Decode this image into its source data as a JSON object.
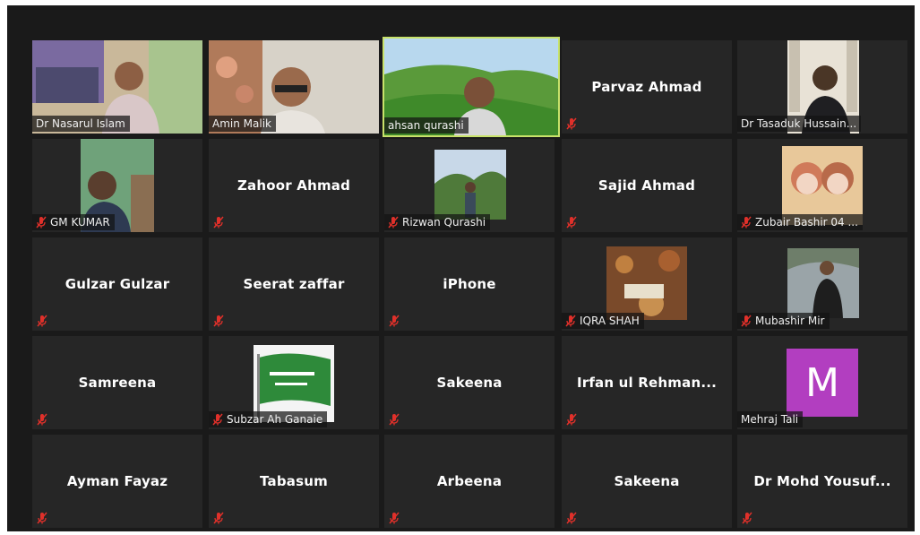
{
  "participants": [
    {
      "name": "Dr Nasarul Islam",
      "muted": false,
      "video": true
    },
    {
      "name": "Amin Malik",
      "muted": false,
      "video": true
    },
    {
      "name": "ahsan qurashi",
      "muted": false,
      "video": true,
      "speaking": true
    },
    {
      "name": "Parvaz Ahmad",
      "muted": true,
      "video": false
    },
    {
      "name": "Dr Tasaduk Hussain...",
      "muted": false,
      "video": true
    },
    {
      "name": "GM KUMAR",
      "muted": true,
      "video": true
    },
    {
      "name": "Zahoor Ahmad",
      "muted": true,
      "video": false
    },
    {
      "name": "Rizwan Qurashi",
      "muted": true,
      "video": true
    },
    {
      "name": "Sajid Ahmad",
      "muted": true,
      "video": false
    },
    {
      "name": "Zubair Bashir 04 ...",
      "muted": true,
      "video": true
    },
    {
      "name": "Gulzar Gulzar",
      "muted": true,
      "video": false
    },
    {
      "name": "Seerat zaffar",
      "muted": true,
      "video": false
    },
    {
      "name": "iPhone",
      "muted": true,
      "video": false
    },
    {
      "name": "IQRA SHAH",
      "muted": true,
      "video": true
    },
    {
      "name": "Mubashir Mir",
      "muted": true,
      "video": true
    },
    {
      "name": "Samreena",
      "muted": true,
      "video": false
    },
    {
      "name": "Subzar Ah Ganaie",
      "muted": true,
      "video": true
    },
    {
      "name": "Sakeena",
      "muted": true,
      "video": false
    },
    {
      "name": "Irfan ul Rehman...",
      "muted": true,
      "video": false
    },
    {
      "name": "Mehraj Tali",
      "muted": false,
      "video": true,
      "avatar_letter": "M"
    },
    {
      "name": "Ayman Fayaz",
      "muted": true,
      "video": false
    },
    {
      "name": "Tabasum",
      "muted": true,
      "video": false
    },
    {
      "name": "Arbeena",
      "muted": true,
      "video": false
    },
    {
      "name": "Sakeena",
      "muted": true,
      "video": false
    },
    {
      "name": "Dr Mohd Yousuf...",
      "muted": true,
      "video": false
    }
  ],
  "colors": {
    "background": "#1a1a1a",
    "tile": "#262626",
    "speaking_border": "#c8e26a",
    "mute_icon": "#e0302a",
    "avatar": "#b23ec0"
  },
  "icons": {
    "mute": "microphone-muted-icon"
  }
}
